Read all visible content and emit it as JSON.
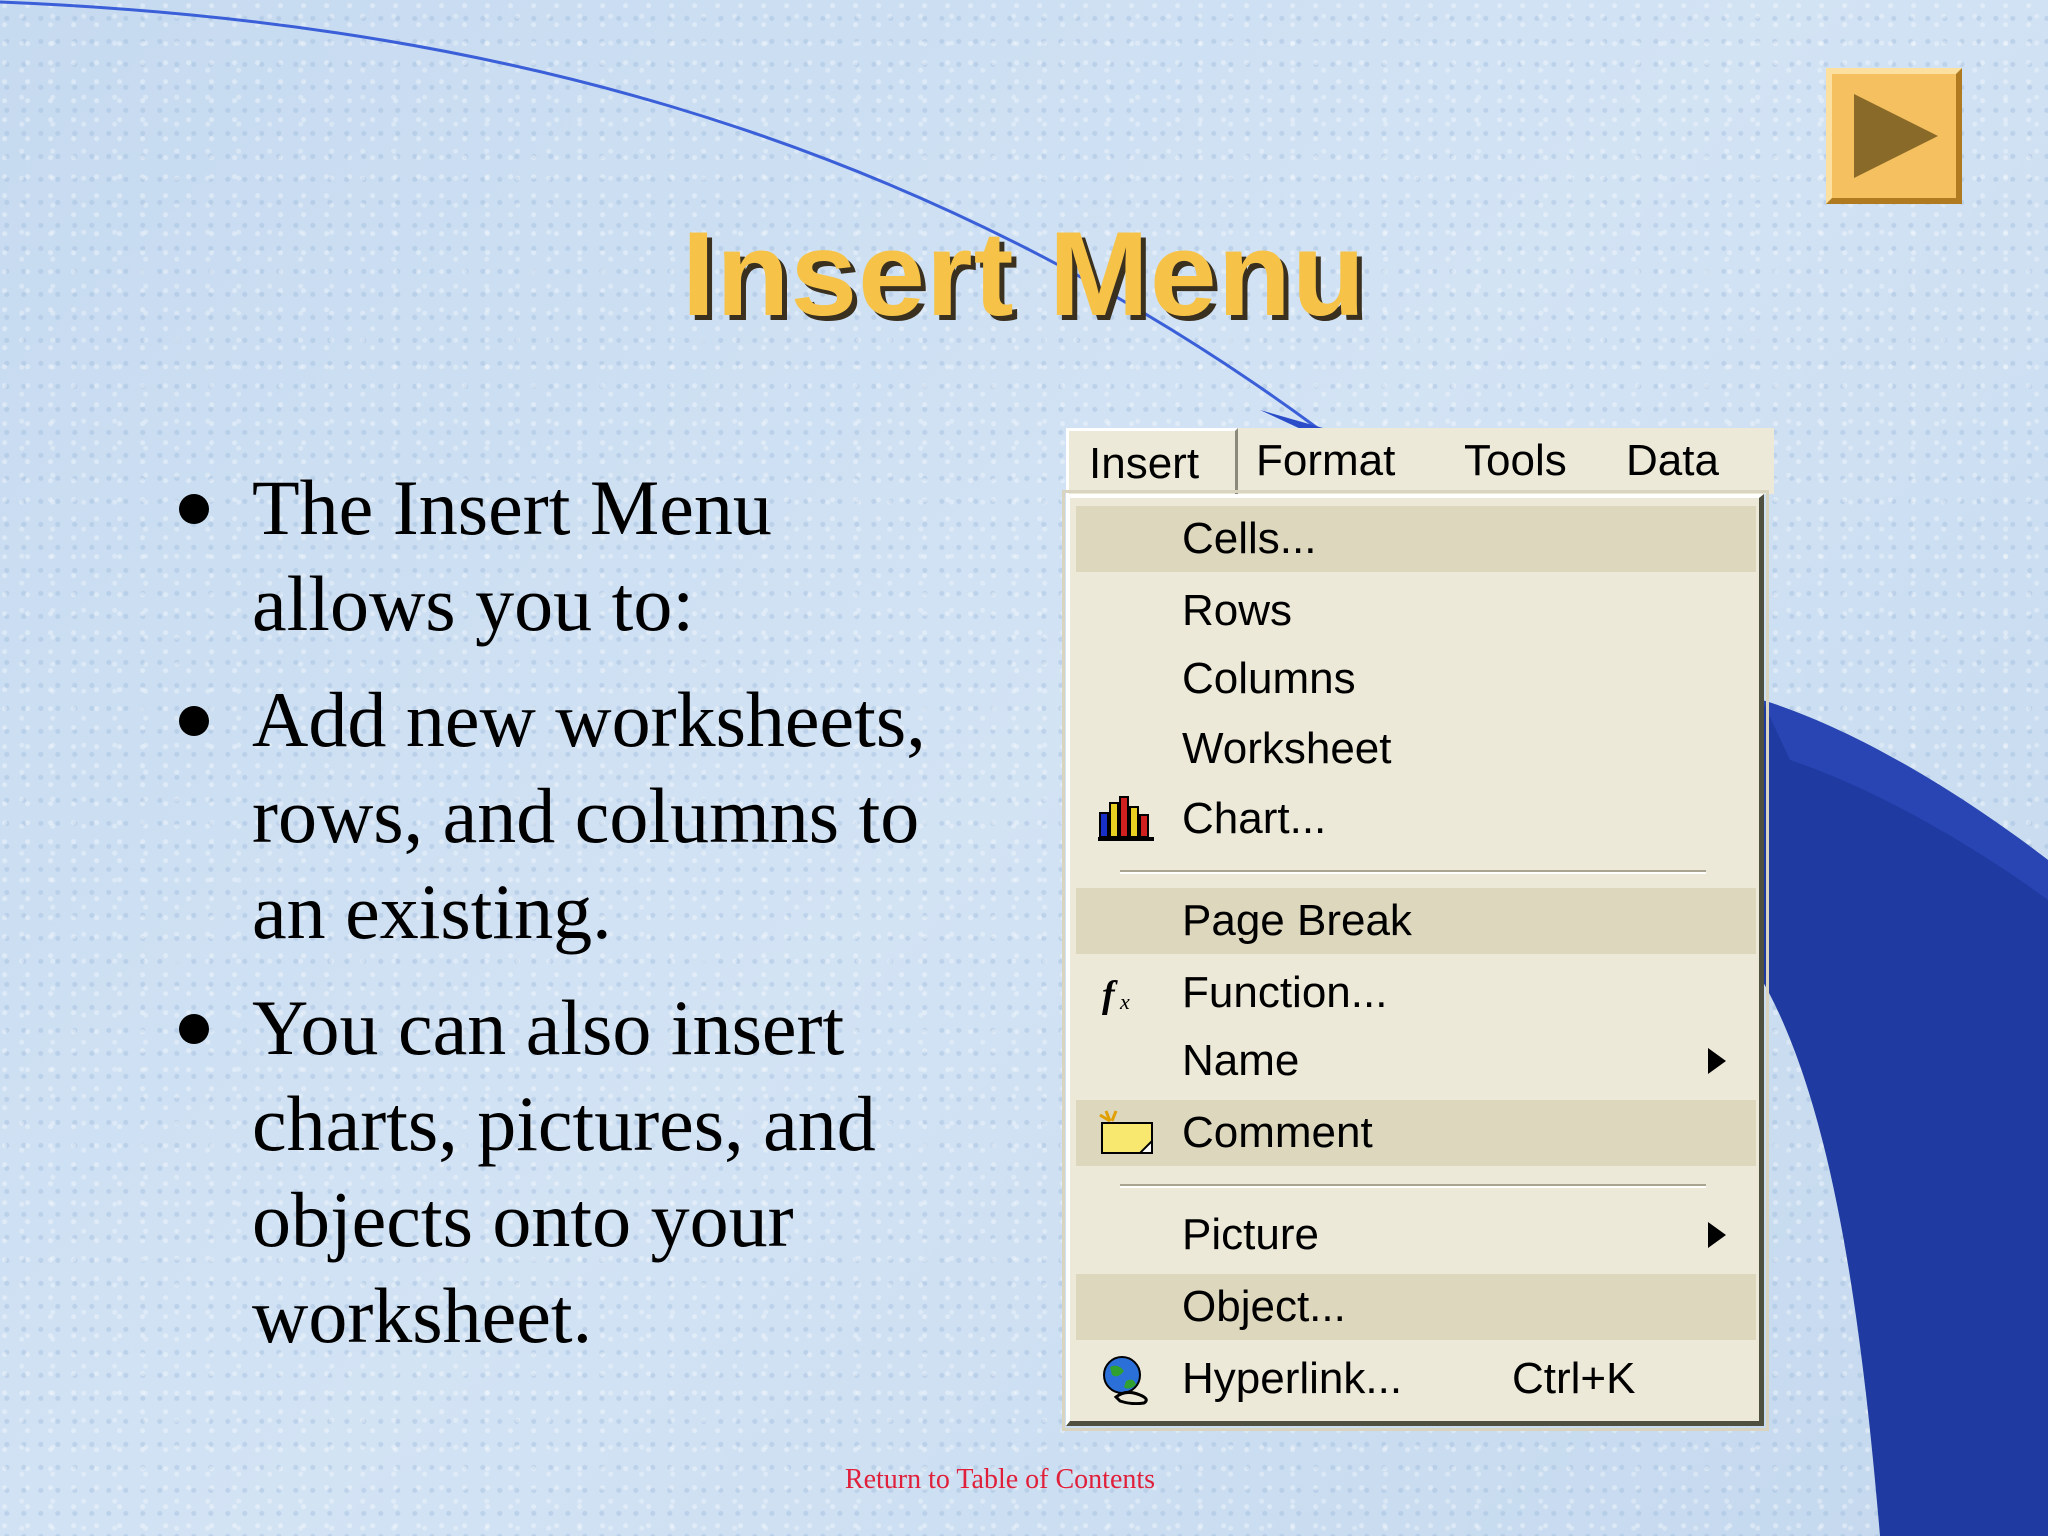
{
  "slide": {
    "title": "Insert Menu",
    "bullets": [
      "The Insert Menu allows you to:",
      "Add new worksheets, rows, and columns to an existing.",
      "You can also insert charts, pictures, and objects onto your worksheet."
    ],
    "footer_link": "Return to Table of Contents"
  },
  "menubar": {
    "items": [
      "Insert",
      "Format",
      "Tools",
      "Data"
    ],
    "active": "Insert"
  },
  "menu": {
    "items": [
      {
        "label": "Cells...",
        "icon": "",
        "highlighted": true
      },
      {
        "label": "Rows",
        "icon": ""
      },
      {
        "label": "Columns",
        "icon": ""
      },
      {
        "label": "Worksheet",
        "icon": ""
      },
      {
        "label": "Chart...",
        "icon": "chart-icon"
      },
      {
        "label": "Page Break",
        "icon": "",
        "highlighted": true
      },
      {
        "label": "Function...",
        "icon": "function-icon"
      },
      {
        "label": "Name",
        "icon": "",
        "submenu": true
      },
      {
        "label": "Comment",
        "icon": "comment-icon",
        "highlighted": true
      },
      {
        "label": "Picture",
        "icon": "",
        "submenu": true
      },
      {
        "label": "Object...",
        "icon": "",
        "highlighted": true
      },
      {
        "label": "Hyperlink...",
        "icon": "hyperlink-icon",
        "shortcut": "Ctrl+K"
      }
    ]
  },
  "colors": {
    "title": "#f6c348",
    "menu_bg": "#ece9d8",
    "link": "#e0203a",
    "deco_blue": "#1f3aa0"
  }
}
